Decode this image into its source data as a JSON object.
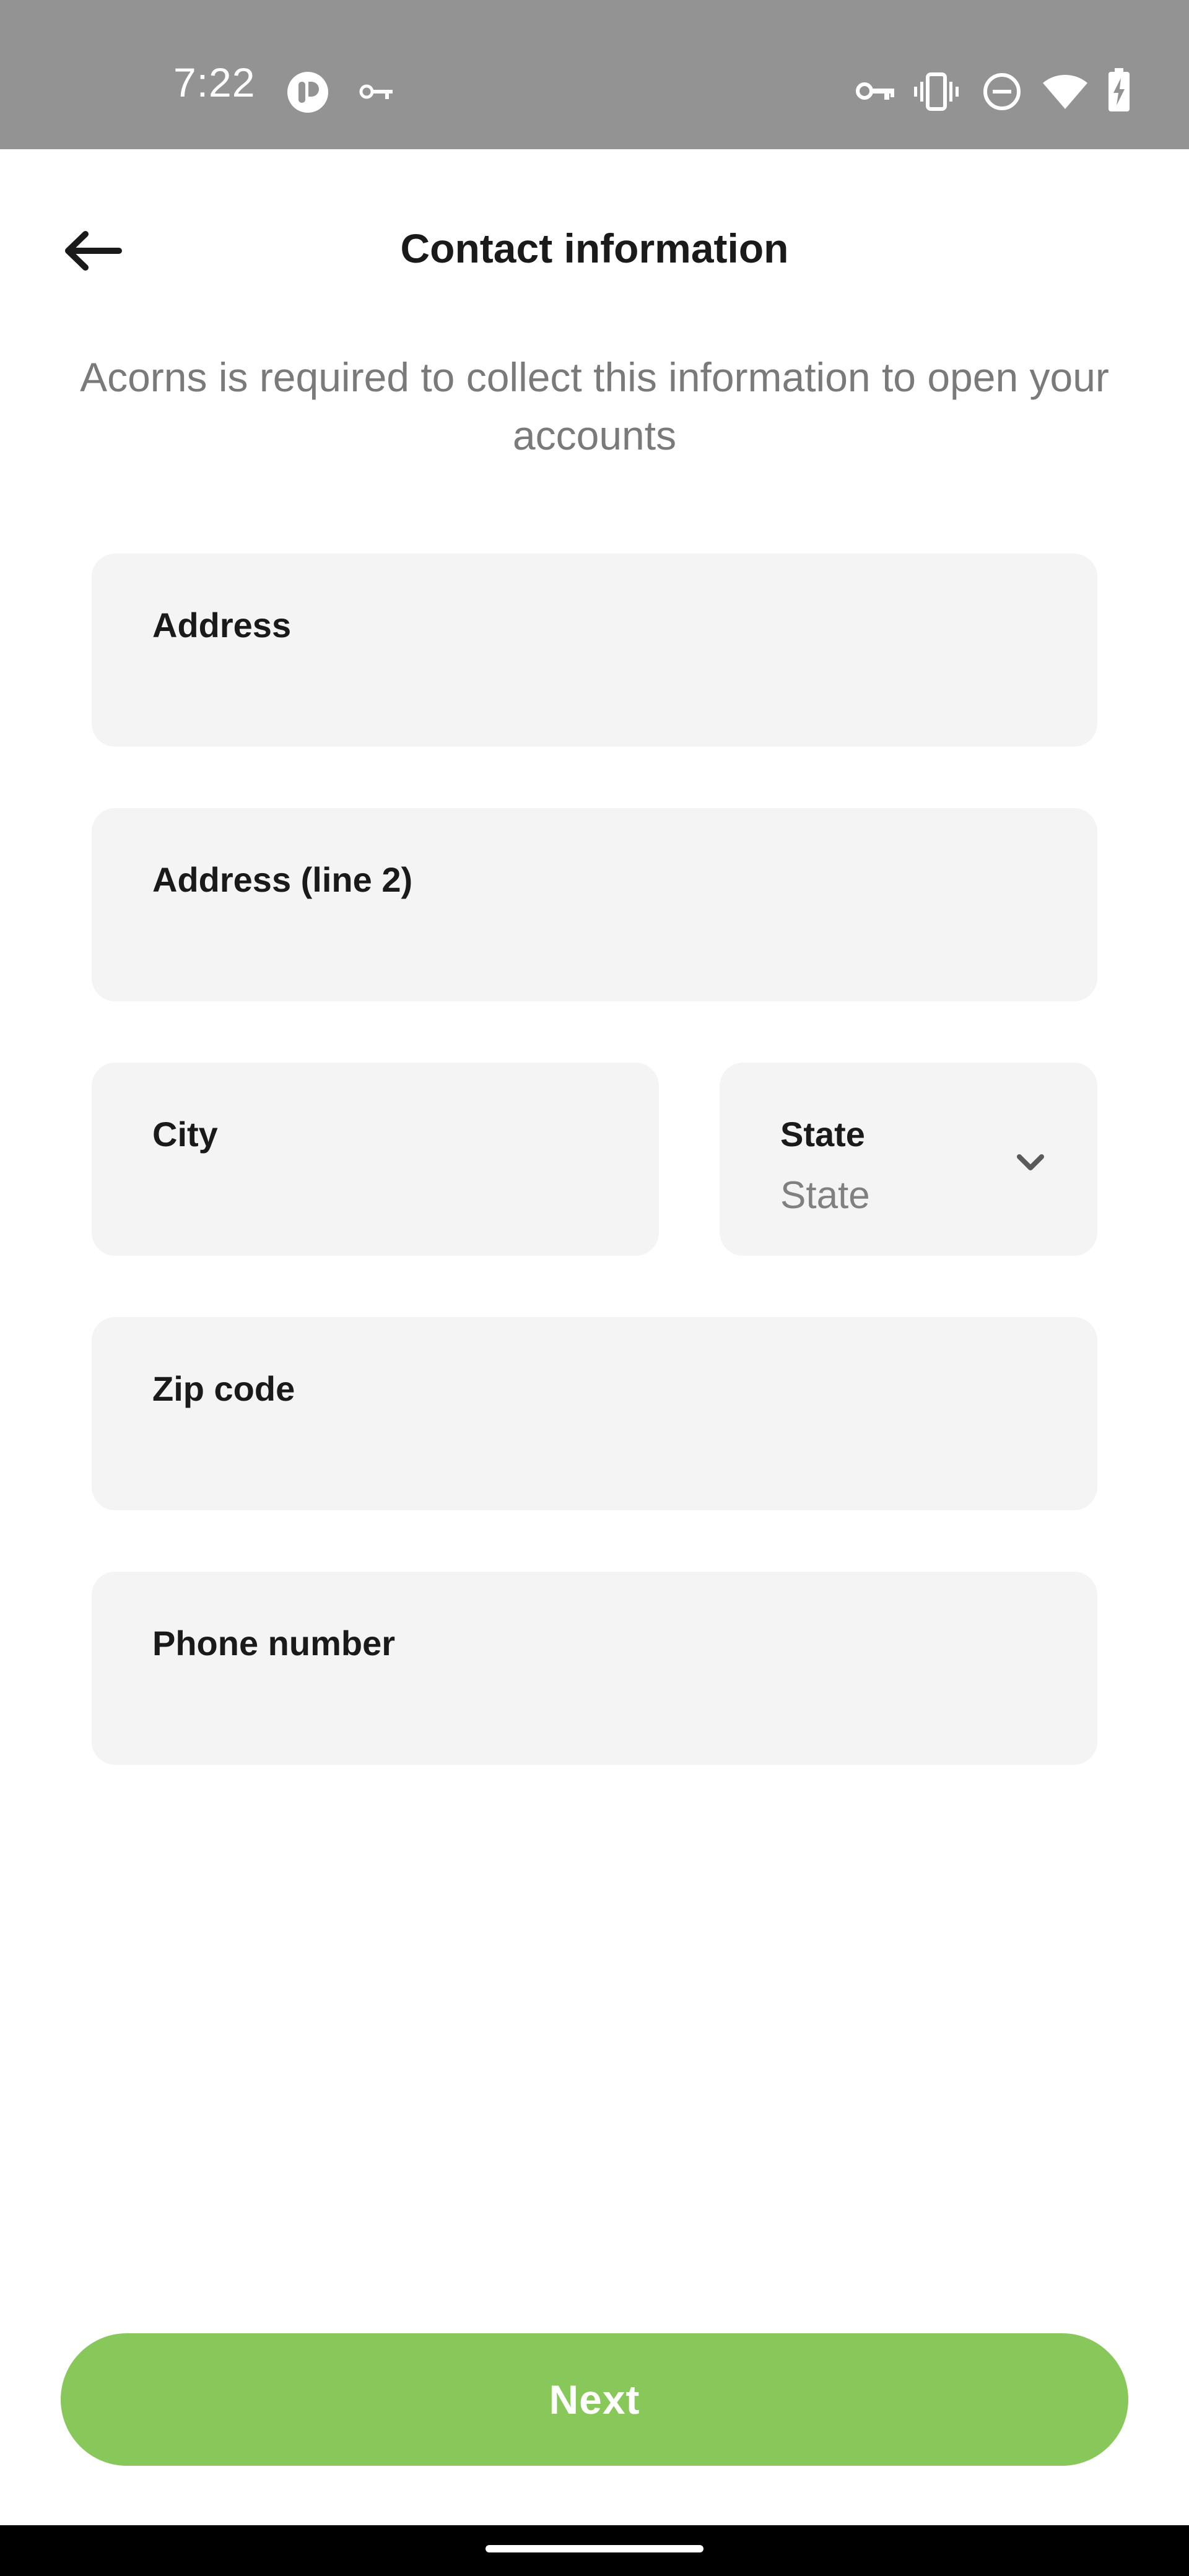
{
  "status_bar": {
    "time": "7:22",
    "left_icons": [
      "app-notification-icon",
      "vpn-key-icon"
    ],
    "right_icons": [
      "vpn-key-icon",
      "vibrate-icon",
      "do-not-disturb-icon",
      "wifi-icon",
      "battery-charging-icon"
    ]
  },
  "header": {
    "back_icon": "arrow-left-icon",
    "title": "Contact information"
  },
  "subtitle": "Acorns is required to collect this information to open your accounts",
  "form": {
    "address": {
      "label": "Address",
      "value": ""
    },
    "address_line2": {
      "label": "Address (line 2)",
      "value": ""
    },
    "city": {
      "label": "City",
      "value": ""
    },
    "state": {
      "label": "State",
      "selected": "State",
      "icon": "chevron-down-icon"
    },
    "zip": {
      "label": "Zip code",
      "value": ""
    },
    "phone": {
      "label": "Phone number",
      "value": ""
    }
  },
  "next_button": {
    "label": "Next"
  },
  "colors": {
    "status_bar": "#939393",
    "field_bg": "#f4f4f4",
    "accent_green": "#88c85a",
    "subtitle_text": "#7a7a7a",
    "title_text": "#1a1a1a"
  }
}
